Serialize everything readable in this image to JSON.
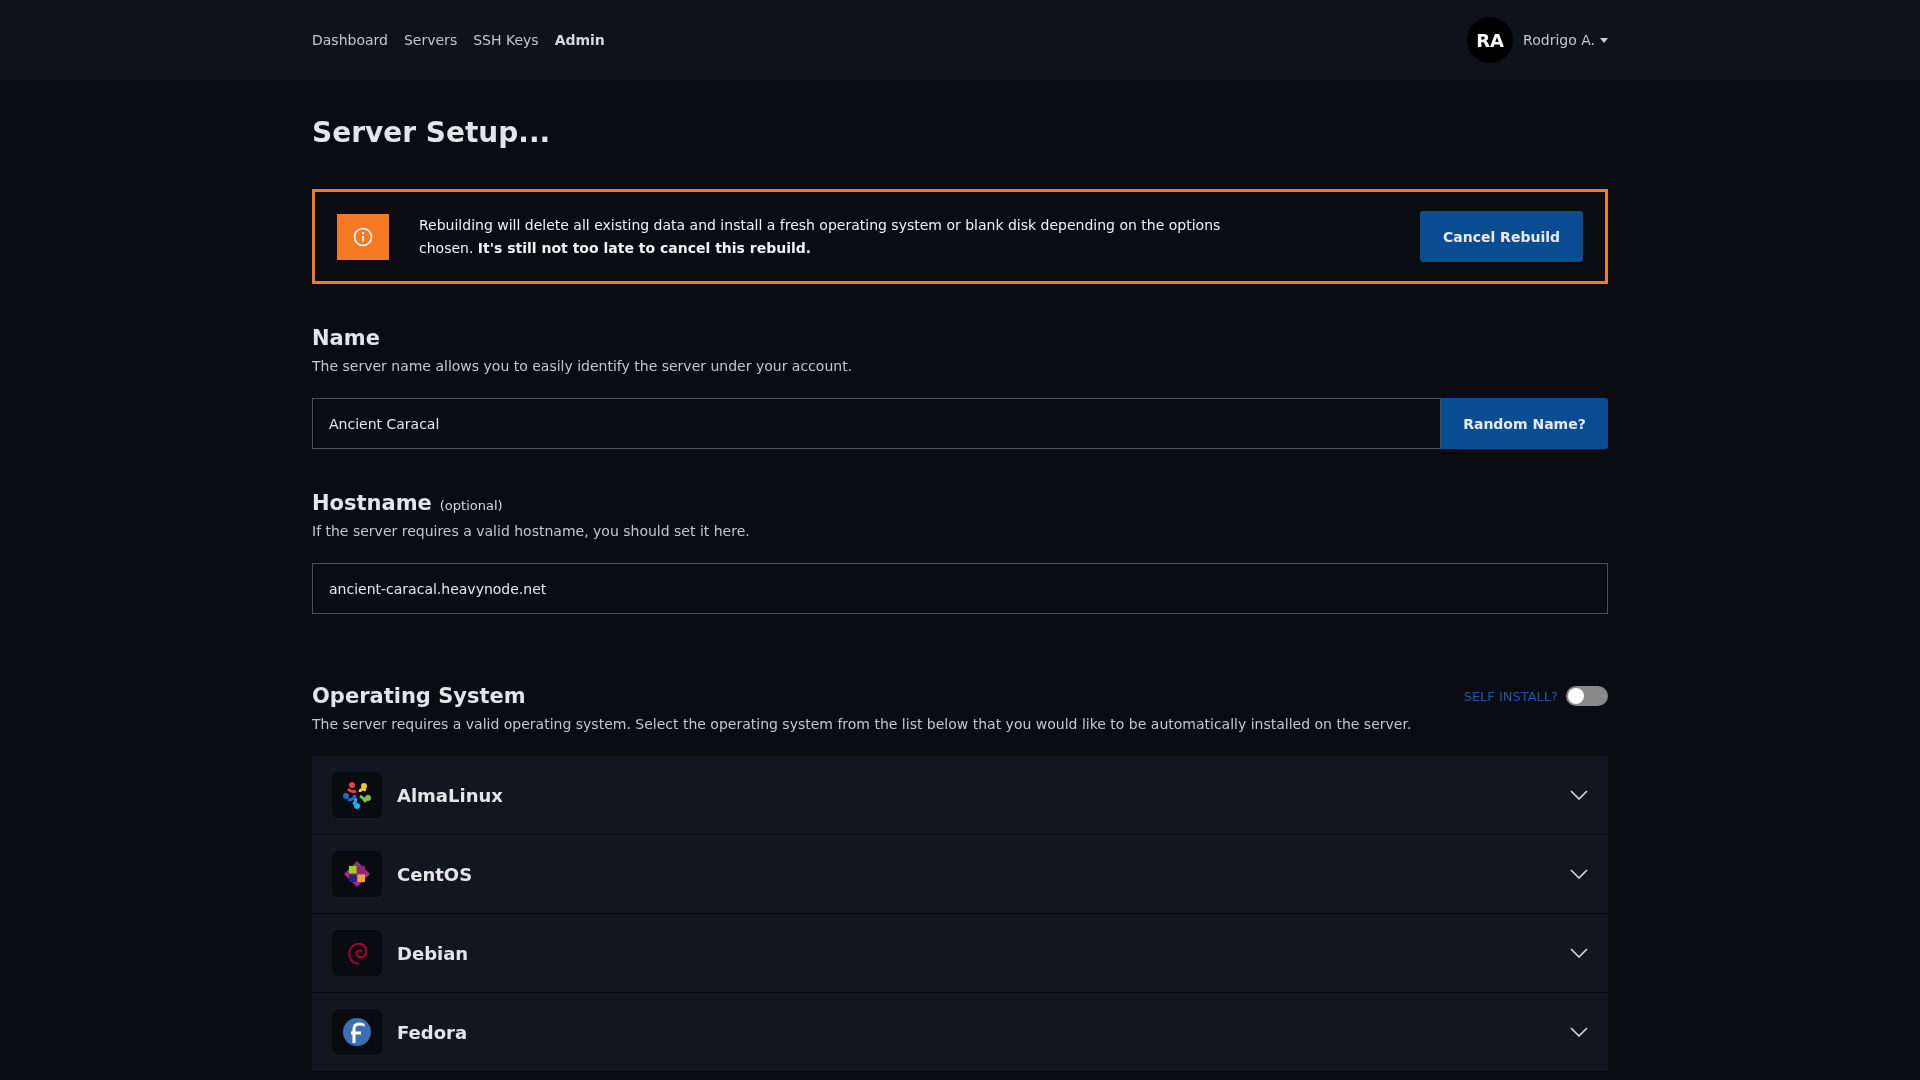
{
  "nav": {
    "links": [
      {
        "label": "Dashboard",
        "selected": false
      },
      {
        "label": "Servers",
        "selected": false
      },
      {
        "label": "SSH Keys",
        "selected": false
      },
      {
        "label": "Admin",
        "selected": true
      }
    ],
    "user": {
      "initials": "RA",
      "name": "Rodrigo A."
    }
  },
  "page_title": "Server Setup...",
  "alert": {
    "text": "Rebuilding will delete all existing data and install a fresh operating system or blank disk depending on the options chosen. **It's still not too late to cancel this rebuild.**",
    "button": "Cancel Rebuild"
  },
  "name_section": {
    "heading": "Name",
    "description": "The server name allows you to easily identify the server under your account.",
    "value": "Ancient Caracal",
    "button": "Random Name?"
  },
  "hostname_section": {
    "heading": "Hostname",
    "note": "(optional)",
    "description": "If the server requires a valid hostname, you should set it here.",
    "value": "ancient-caracal.heavynode.net"
  },
  "os_section": {
    "heading": "Operating System",
    "description": "The server requires a valid operating system. Select the operating system from the list below that you would like to be automatically installed on the server.",
    "self_install": {
      "label": "SELF INSTALL?",
      "on": false
    },
    "items": [
      {
        "name": "AlmaLinux",
        "kind": "alma",
        "expanded": false
      },
      {
        "name": "CentOS",
        "kind": "centos",
        "expanded": false
      },
      {
        "name": "Debian",
        "kind": "debian",
        "expanded": false
      },
      {
        "name": "Fedora",
        "kind": "fedora",
        "expanded": false
      }
    ]
  }
}
